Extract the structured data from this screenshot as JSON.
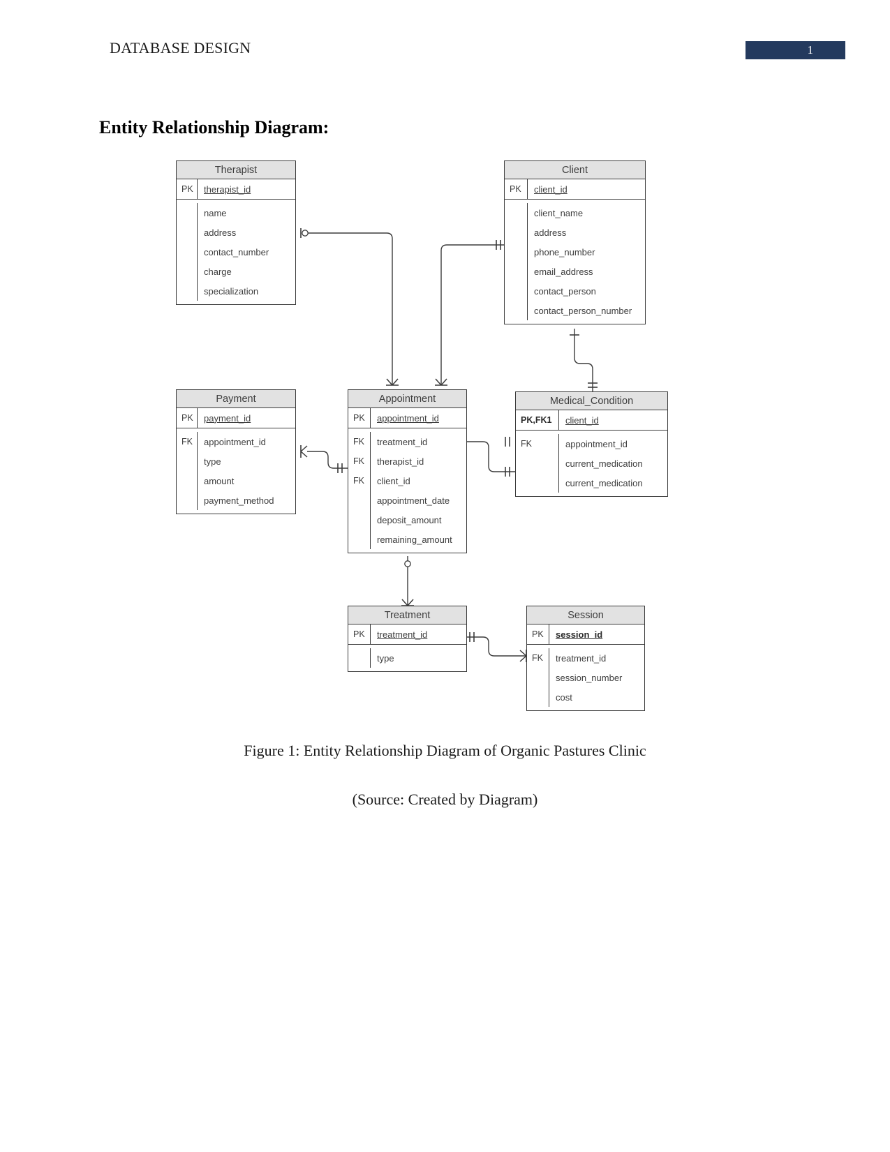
{
  "header": {
    "title": "DATABASE DESIGN",
    "page_number": "1",
    "accent_color": "#243a5e"
  },
  "section": {
    "heading": "Entity Relationship Diagram:"
  },
  "captions": {
    "figure": "Figure 1: Entity Relationship Diagram of Organic Pastures Clinic",
    "source": "(Source: Created by Diagram)"
  },
  "diagram": {
    "title_fill": "#e2e2e2",
    "border_color": "#3b3b3b",
    "entities": {
      "therapist": {
        "name": "Therapist",
        "pk_key": "PK",
        "pk_field": "therapist_id",
        "attributes": [
          {
            "key": "",
            "name": "name"
          },
          {
            "key": "",
            "name": "address"
          },
          {
            "key": "",
            "name": "contact_number"
          },
          {
            "key": "",
            "name": "charge"
          },
          {
            "key": "",
            "name": "specialization"
          }
        ]
      },
      "client": {
        "name": "Client",
        "pk_key": "PK",
        "pk_field": "client_id",
        "attributes": [
          {
            "key": "",
            "name": "client_name"
          },
          {
            "key": "",
            "name": "address"
          },
          {
            "key": "",
            "name": "phone_number"
          },
          {
            "key": "",
            "name": "email_address"
          },
          {
            "key": "",
            "name": "contact_person"
          },
          {
            "key": "",
            "name": "contact_person_number"
          }
        ]
      },
      "payment": {
        "name": "Payment",
        "pk_key": "PK",
        "pk_field": "payment_id",
        "attributes": [
          {
            "key": "FK",
            "name": "appointment_id"
          },
          {
            "key": "",
            "name": "type"
          },
          {
            "key": "",
            "name": "amount"
          },
          {
            "key": "",
            "name": "payment_method"
          }
        ]
      },
      "appointment": {
        "name": "Appointment",
        "pk_key": "PK",
        "pk_field": "appointment_id",
        "attributes": [
          {
            "key": "FK",
            "name": "treatment_id"
          },
          {
            "key": "FK",
            "name": "therapist_id"
          },
          {
            "key": "FK",
            "name": "client_id"
          },
          {
            "key": "",
            "name": "appointment_date"
          },
          {
            "key": "",
            "name": "deposit_amount"
          },
          {
            "key": "",
            "name": "remaining_amount"
          }
        ]
      },
      "medical_condition": {
        "name": "Medical_Condition",
        "pk_key": "PK,FK1",
        "pk_field": "client_id",
        "attributes": [
          {
            "key": "FK",
            "name": "appointment_id"
          },
          {
            "key": "",
            "name": "current_medication"
          },
          {
            "key": "",
            "name": "current_medication"
          }
        ]
      },
      "treatment": {
        "name": "Treatment",
        "pk_key": "PK",
        "pk_field": "treatment_id",
        "attributes": [
          {
            "key": "",
            "name": "type"
          }
        ]
      },
      "session": {
        "name": "Session",
        "pk_key": "PK",
        "pk_field": "session_id",
        "attributes": [
          {
            "key": "FK",
            "name": "treatment_id"
          },
          {
            "key": "",
            "name": "session_number"
          },
          {
            "key": "",
            "name": "cost"
          }
        ]
      }
    }
  }
}
